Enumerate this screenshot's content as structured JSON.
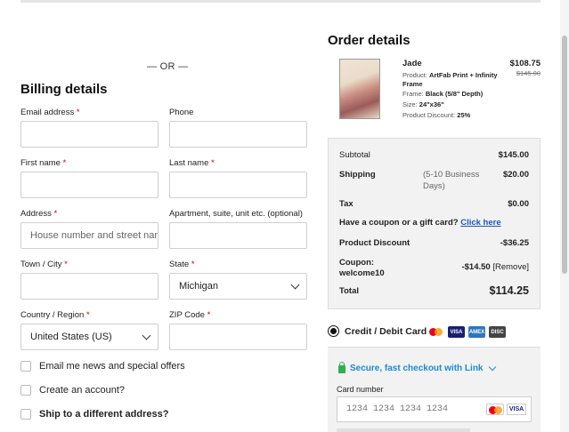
{
  "or_divider": "— OR —",
  "billing": {
    "title": "Billing details",
    "email_label": "Email address",
    "phone_label": "Phone",
    "first_name_label": "First name",
    "last_name_label": "Last name",
    "address_label": "Address",
    "address_placeholder": "House number and street name",
    "apt_label": "Apartment, suite, unit etc. (optional)",
    "town_label": "Town / City",
    "state_label": "State",
    "state_value": "Michigan",
    "country_label": "Country / Region",
    "country_value": "United States (US)",
    "zip_label": "ZIP Code",
    "required_mark": "*"
  },
  "checkboxes": {
    "email_news": "Email me news and special offers",
    "create_account": "Create an account?",
    "ship_different": "Ship to a different address?"
  },
  "order": {
    "title": "Order details",
    "product": {
      "name": "Jade",
      "price": "$108.75",
      "old_price": "$145.00",
      "product_label": "Product:",
      "product_value": "ArtFab Print + Infinity Frame",
      "frame_label": "Frame:",
      "frame_value": "Black (5/8\" Depth)",
      "size_label": "Size:",
      "size_value": "24\"x36\"",
      "discount_label": "Product Discount:",
      "discount_value": "25%"
    },
    "summary": {
      "subtotal_label": "Subtotal",
      "subtotal_value": "$145.00",
      "shipping_label": "Shipping",
      "shipping_note": "(5-10 Business Days)",
      "shipping_value": "$20.00",
      "tax_label": "Tax",
      "tax_value": "$0.00",
      "coupon_prompt": "Have a coupon or a gift card?",
      "coupon_link": "Click here",
      "product_discount_label": "Product Discount",
      "product_discount_value": "-$36.25",
      "coupon_label": "Coupon:",
      "coupon_code": "welcome10",
      "coupon_value": "-$14.50",
      "remove_label": "[Remove]",
      "total_label": "Total",
      "total_value": "$114.25"
    }
  },
  "payment": {
    "method_label": "Credit / Debit Card",
    "link_text": "Secure, fast checkout with Link",
    "card_number_label": "Card number",
    "card_number_placeholder": "1234 1234 1234 1234",
    "visa_label": "VISA",
    "amex_label": "AMEX",
    "discover_label": "DISC"
  }
}
